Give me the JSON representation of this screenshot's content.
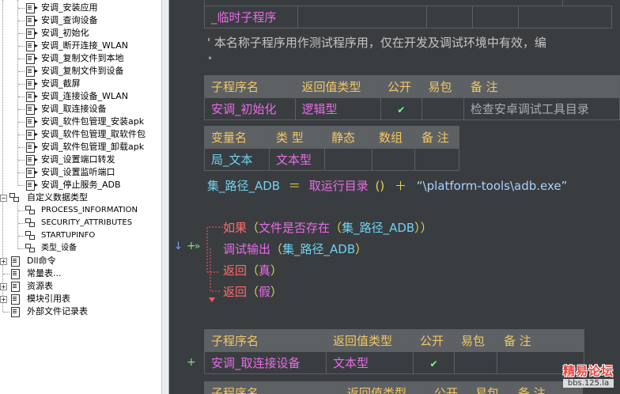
{
  "tree": {
    "subs": [
      "安调_安装应用",
      "安调_查询设备",
      "安调_初始化",
      "安调_断开连接_WLAN",
      "安调_复制文件到本地",
      "安调_复制文件到设备",
      "安调_截屏",
      "安调_连接设备_WLAN",
      "安调_取连接设备",
      "安调_软件包管理_安装apk",
      "安调_软件包管理_取软件包",
      "安调_软件包管理_卸载apk",
      "安调_设置端口转发",
      "安调_设置监听端口",
      "安调_停止服务_ADB"
    ],
    "custom_types_label": "自定义数据类型",
    "types": [
      "PROCESS_INFORMATION",
      "SECURITY_ATTRIBUTES",
      "STARTUPINFO",
      "类型_设备"
    ],
    "roots": [
      {
        "label": "Dll命令",
        "expander": "+"
      },
      {
        "label": "常量表...",
        "expander": ""
      },
      {
        "label": "资源表",
        "expander": "+"
      },
      {
        "label": "模块引用表",
        "expander": "+"
      },
      {
        "label": "外部文件记录表",
        "expander": ""
      }
    ]
  },
  "editor": {
    "top_table_cell": "_临时子程序",
    "comment": "' 本名称子程序用作测试程序用，仅在开发及调试环境中有效，编",
    "bullet": "•",
    "sub_header": [
      "子程序名",
      "返回值类型",
      "公开",
      "易包",
      "备 注"
    ],
    "sub1": {
      "name": "安调_初始化",
      "return_type": "逻辑型",
      "public_mark": "✔",
      "note": "检查安卓调试工具目录"
    },
    "var_header": [
      "变量名",
      "类 型",
      "静态",
      "数组",
      "备 注"
    ],
    "var1": {
      "name": "局_文本",
      "type": "文本型"
    },
    "assign": {
      "target": "集_路径_ADB",
      "eq": "＝",
      "func": "取运行目录",
      "parens": "()",
      "plus": "＋",
      "str": "“\\platform-tools\\adb.exe”"
    },
    "if_line": {
      "kw": "如果",
      "open": "（",
      "func": "文件是否存在",
      "arg_open": "（",
      "arg": "集_路径_ADB",
      "close": "））"
    },
    "debug_line": {
      "func": "调试输出",
      "open": "（",
      "arg": "集_路径_ADB",
      "close": "）"
    },
    "ret_true": {
      "kw": "返回",
      "open": "（",
      "val": "真",
      "close": "）"
    },
    "ret_false": {
      "kw": "返回",
      "open": "（",
      "val": "假",
      "close": "）"
    },
    "gutter_marks": {
      "arrow": "↓",
      "plus": "+",
      "dbl": "»",
      "plus2": "+"
    },
    "sub2": {
      "name": "安调_取连接设备",
      "return_type": "文本型",
      "public_mark": "✔"
    },
    "bottom_header": [
      "子程序名",
      "返回值类型",
      "公开",
      "易包",
      "备 注"
    ]
  },
  "watermark": {
    "title": "精易论坛",
    "site": "bbs.125.la"
  }
}
